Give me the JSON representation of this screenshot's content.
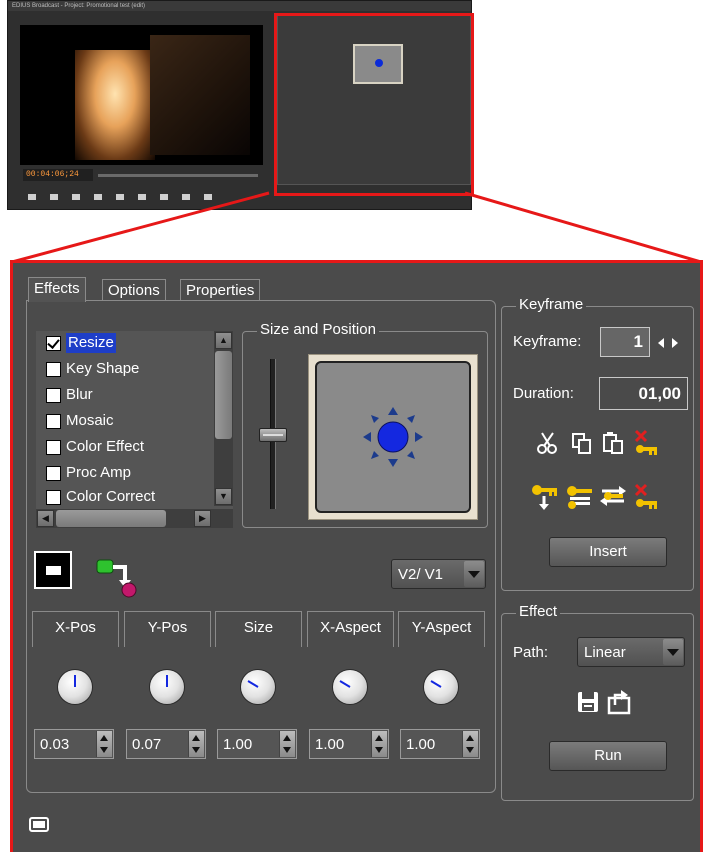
{
  "thumbnail": {
    "window_title": "EDIUS Broadcast - Project: Promotional test (edit)",
    "timecode": "00:04:06;24"
  },
  "panel": {
    "tabs": [
      {
        "label": "Effects",
        "active": true
      },
      {
        "label": "Options",
        "active": false
      },
      {
        "label": "Properties",
        "active": false
      }
    ],
    "effects": [
      {
        "label": "Resize",
        "checked": true,
        "selected": true
      },
      {
        "label": "Key Shape",
        "checked": false,
        "selected": false
      },
      {
        "label": "Blur",
        "checked": false,
        "selected": false
      },
      {
        "label": "Mosaic",
        "checked": false,
        "selected": false
      },
      {
        "label": "Color Effect",
        "checked": false,
        "selected": false
      },
      {
        "label": "Proc Amp",
        "checked": false,
        "selected": false
      },
      {
        "label": "Color Correct",
        "checked": false,
        "selected": false
      }
    ],
    "size_position_title": "Size and Position",
    "track_select": "V2/ V1",
    "params": [
      {
        "label": "X-Pos",
        "value": "0.03"
      },
      {
        "label": "Y-Pos",
        "value": "0.07"
      },
      {
        "label": "Size",
        "value": "1.00"
      },
      {
        "label": "X-Aspect",
        "value": "1.00"
      },
      {
        "label": "Y-Aspect",
        "value": "1.00"
      }
    ],
    "keyframe": {
      "group_title": "Keyframe",
      "keyframe_label": "Keyframe:",
      "keyframe_value": "1",
      "duration_label": "Duration:",
      "duration_value": "01,00",
      "insert_label": "Insert"
    },
    "effect": {
      "group_title": "Effect",
      "path_label": "Path:",
      "path_value": "Linear",
      "run_label": "Run"
    }
  },
  "colors": {
    "highlight_red": "#e61818",
    "selection_blue": "#1e3ec8",
    "panel_bg": "#4b4b4b",
    "position_dot": "#1428e0"
  }
}
